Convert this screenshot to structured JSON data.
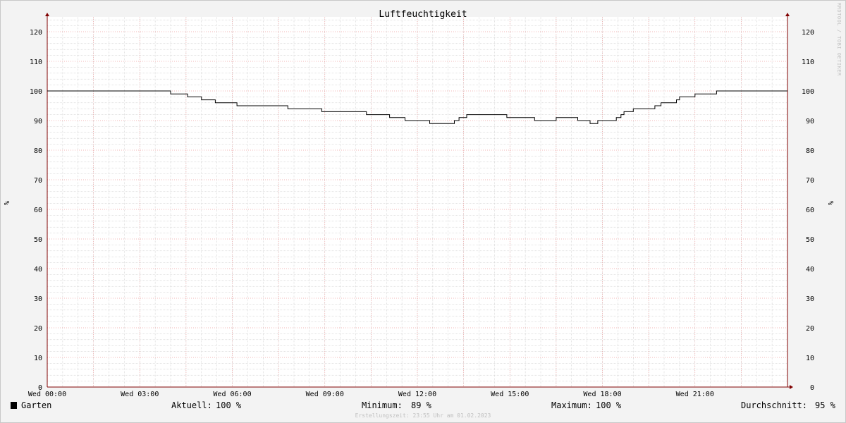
{
  "chart_data": {
    "type": "line",
    "title": "Luftfeuchtigkeit",
    "ylabel": "%",
    "xlabel": "",
    "ylim": [
      0,
      125
    ],
    "xlim": [
      0,
      24
    ],
    "yticks": [
      0,
      10,
      20,
      30,
      40,
      50,
      60,
      70,
      80,
      90,
      100,
      110,
      120
    ],
    "xticks": [
      {
        "t": 0,
        "label": "Wed 00:00"
      },
      {
        "t": 3,
        "label": "Wed 03:00"
      },
      {
        "t": 6,
        "label": "Wed 06:00"
      },
      {
        "t": 9,
        "label": "Wed 09:00"
      },
      {
        "t": 12,
        "label": "Wed 12:00"
      },
      {
        "t": 15,
        "label": "Wed 15:00"
      },
      {
        "t": 18,
        "label": "Wed 18:00"
      },
      {
        "t": 21,
        "label": "Wed 21:00"
      }
    ],
    "grid": true,
    "line_color": "#000000",
    "major_grid_color": "#f0a0a0",
    "minor_grid_color": "#c8c8c8",
    "axis_color": "#800000",
    "series": [
      {
        "name": "Garten",
        "t": [
          0,
          4.0,
          4.55,
          5.0,
          5.45,
          6.15,
          7.8,
          8.9,
          10.3,
          10.35,
          11.1,
          11.6,
          12.4,
          13.2,
          13.35,
          13.6,
          14.9,
          15.8,
          16.5,
          17.2,
          17.6,
          17.85,
          18.1,
          18.45,
          18.6,
          18.7,
          19.0,
          19.7,
          19.9,
          20.4,
          20.5,
          20.6,
          21.0,
          21.7,
          24.0
        ],
        "values": [
          100,
          99,
          98,
          97,
          96,
          95,
          94,
          93,
          93,
          92,
          91,
          90,
          89,
          90,
          91,
          92,
          91,
          90,
          91,
          90,
          89,
          90,
          90,
          91,
          92,
          93,
          94,
          95,
          96,
          97,
          98,
          98,
          99,
          100,
          100
        ]
      }
    ]
  },
  "legend": {
    "series_name": "Garten",
    "series_color": "#000000",
    "current_label": "Aktuell:",
    "current_value": "100 %",
    "min_label": "Minimum:",
    "min_value": "89 %",
    "max_label": "Maximum:",
    "max_value": "100 %",
    "avg_label": "Durchschnitt:",
    "avg_value": "95 %"
  },
  "footer": "Erstellungszeit: 23:55 Uhr am 01.02.2023",
  "watermark": "RRDTOOL / TOBI OETIKER"
}
